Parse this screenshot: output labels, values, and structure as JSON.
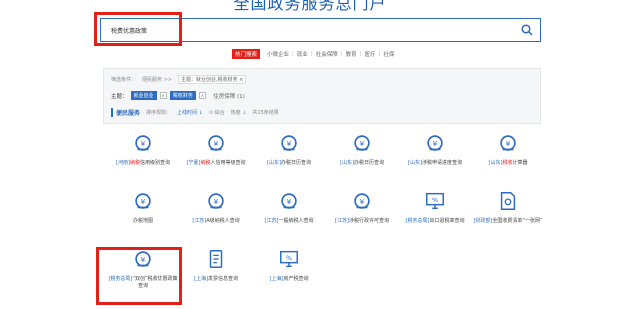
{
  "header": {
    "title": "全国政务服务总门户"
  },
  "search": {
    "value": "税费优惠政策"
  },
  "hot": {
    "tag": "热门搜索",
    "items": [
      "小微企业",
      "就业",
      "社会保障",
      "教育",
      "医疗",
      "社保"
    ]
  },
  "filters": {
    "prefix": "筛选条件：",
    "crumb1": "便民服务 >>",
    "label_topic": "主题：",
    "crumb2": "主题：就业创业,税收财务",
    "crumb2_x": "×",
    "chips": [
      "就业创业",
      "税收财务"
    ],
    "chip_x": "×",
    "other": "住房保障 (1)"
  },
  "service_bar": {
    "title": "便民服务",
    "sort_label": "排序规则：",
    "sort_time": "上线时间",
    "sort_compound": "综合",
    "sort_hot": "热度",
    "count": "共15条结果"
  },
  "tiles": [
    {
      "prefix": "[河南]",
      "hl": "纳税",
      "rest": "信用级别查询"
    },
    {
      "prefix": "[宁夏]",
      "hl": "纳税",
      "rest": "人信用等级查询"
    },
    {
      "prefix": "[山东]",
      "hl": "",
      "rest": "办税日历查询"
    },
    {
      "prefix": "[山东]",
      "hl": "",
      "rest": "办税日历查询"
    },
    {
      "prefix": "[山东]",
      "hl": "",
      "rest": "涉税申请进度查询"
    },
    {
      "prefix": "[山东]",
      "hl": "税收",
      "rest": "计算器"
    },
    {
      "prefix": "",
      "hl": "",
      "rest": "办税地图"
    },
    {
      "prefix": "[江苏]",
      "hl": "",
      "rest": "A级纳税人查询"
    },
    {
      "prefix": "[江苏]",
      "hl": "",
      "rest": "一般纳税人查询"
    },
    {
      "prefix": "[江苏]",
      "hl": "",
      "rest": "涉税行政许可查询"
    },
    {
      "prefix": "[税务总局]",
      "hl": "",
      "rest": "出口退税率查询"
    },
    {
      "prefix": "[财政部]",
      "hl": "",
      "rest": "全国收费清单“一张网”"
    },
    {
      "prefix": "[税务总局]",
      "hl": "",
      "rest": "“双创”税收优惠政策查询"
    },
    {
      "prefix": "[上海]",
      "hl": "",
      "rest": "发票信息查询"
    },
    {
      "prefix": "[上海]",
      "hl": "",
      "rest": "房产税查询"
    }
  ],
  "colors": {
    "accent": "#2d6cc0",
    "highlight": "#e32017"
  }
}
